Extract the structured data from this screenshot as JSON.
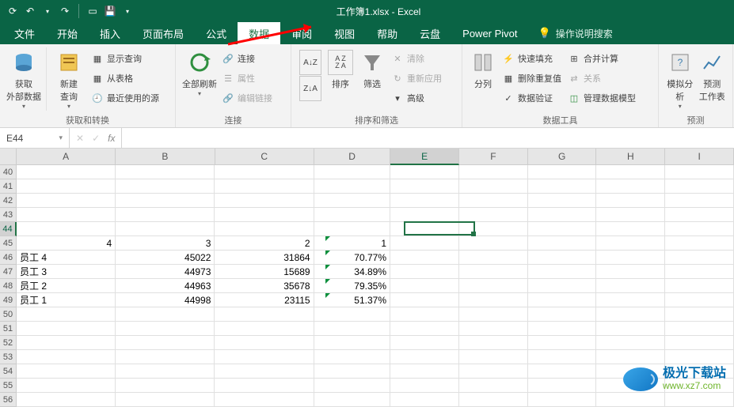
{
  "app": {
    "title": "工作簿1.xlsx - Excel"
  },
  "qat": {
    "autosave_icon": "autosave",
    "undo_icon": "undo",
    "redo_icon": "redo",
    "save_icon": "save",
    "touch_icon": "touch"
  },
  "tabs": {
    "file": "文件",
    "home": "开始",
    "insert": "插入",
    "pagelayout": "页面布局",
    "formulas": "公式",
    "data": "数据",
    "review": "审阅",
    "view": "视图",
    "help": "帮助",
    "cloud": "云盘",
    "pivot": "Power Pivot",
    "tell_me": "操作说明搜索"
  },
  "ribbon": {
    "group1": {
      "get_data": "获取\n外部数据",
      "new_query": "新建\n查询",
      "show_queries": "显示查询",
      "from_table": "从表格",
      "recent": "最近使用的源",
      "label": "获取和转换"
    },
    "group2": {
      "refresh_all": "全部刷新",
      "connections": "连接",
      "properties": "属性",
      "edit_links": "编辑链接",
      "label": "连接"
    },
    "group3": {
      "sort_asc": "A→Z",
      "sort_desc": "Z→A",
      "sort": "排序",
      "filter": "筛选",
      "clear": "清除",
      "reapply": "重新应用",
      "advanced": "高级",
      "label": "排序和筛选"
    },
    "group4": {
      "text_to_cols": "分列",
      "flash_fill": "快速填充",
      "remove_dup": "删除重复值",
      "data_valid": "数据验证",
      "consolidate": "合并计算",
      "relationships": "关系",
      "data_model": "管理数据模型",
      "label": "数据工具"
    },
    "group5": {
      "whatif": "模拟分析",
      "forecast": "预测\n工作表",
      "label": "预测"
    }
  },
  "fbar": {
    "name": "E44",
    "fx": "fx"
  },
  "grid": {
    "col_widths": {
      "A": 130,
      "B": 130,
      "C": 130,
      "D": 100,
      "E": 90,
      "F": 90,
      "G": 90,
      "H": 90,
      "I": 90
    },
    "cols": [
      "A",
      "B",
      "C",
      "D",
      "E",
      "F",
      "G",
      "H",
      "I"
    ],
    "row_start": 40,
    "row_end": 56,
    "selected": {
      "col": "E",
      "row": 44
    },
    "data": {
      "45": {
        "A": "4",
        "B": "3",
        "C": "2",
        "D": "1"
      },
      "46": {
        "A": "员工 4",
        "B": "45022",
        "C": "31864",
        "D": "70.77%"
      },
      "47": {
        "A": "员工 3",
        "B": "44973",
        "C": "15689",
        "D": "34.89%"
      },
      "48": {
        "A": "员工 2",
        "B": "44963",
        "C": "35678",
        "D": "79.35%"
      },
      "49": {
        "A": "员工 1",
        "B": "44998",
        "C": "23115",
        "D": "51.37%"
      }
    },
    "green_marks": [
      {
        "row": 45,
        "col": "D"
      },
      {
        "row": 46,
        "col": "D"
      },
      {
        "row": 47,
        "col": "D"
      },
      {
        "row": 48,
        "col": "D"
      },
      {
        "row": 49,
        "col": "D"
      }
    ]
  },
  "watermark": {
    "t1": "极光下载站",
    "t2": "www.xz7.com"
  }
}
